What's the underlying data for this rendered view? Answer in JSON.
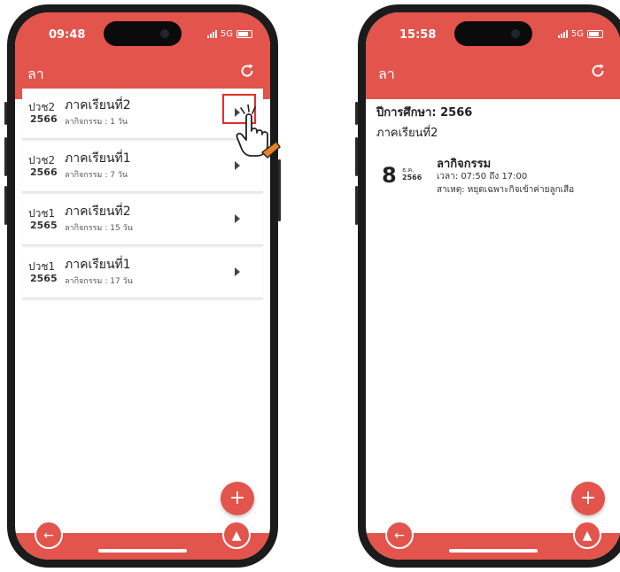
{
  "left_phone": {
    "status_time": "09:48",
    "network": "5G",
    "app_title": "ลา",
    "items": [
      {
        "code": "ปวช2",
        "year": "2566",
        "term": "ภาคเรียนที่2",
        "leave_type": "ลากิจกรรม",
        "days": ": 1 วัน"
      },
      {
        "code": "ปวช2",
        "year": "2566",
        "term": "ภาคเรียนที่1",
        "leave_type": "ลากิจกรรม",
        "days": ": 7 วัน"
      },
      {
        "code": "ปวช1",
        "year": "2565",
        "term": "ภาคเรียนที่2",
        "leave_type": "ลากิจกรรม",
        "days": ": 15 วัน"
      },
      {
        "code": "ปวช1",
        "year": "2565",
        "term": "ภาคเรียนที่1",
        "leave_type": "ลากิจกรรม",
        "days": ": 17 วัน"
      }
    ],
    "fab_label": "+",
    "back_label": "←",
    "up_label": "▲"
  },
  "right_phone": {
    "status_time": "15:58",
    "network": "5G",
    "app_title": "ลา",
    "academic_year": "ปีการศึกษา: 2566",
    "term": "ภาคเรียนที่2",
    "entry": {
      "day": "8",
      "month": "ธ.ค.",
      "year": "2566",
      "title": "ลากิจกรรม",
      "time": "เวลา: 07:50 ถึง 17:00",
      "reason": "สาเหตุ: หยุดเฉพาะกิจเข้าค่ายลูกเสือ"
    },
    "fab_label": "+",
    "back_label": "←",
    "up_label": "▲"
  },
  "colors": {
    "accent": "#e2544c",
    "highlight": "#e0302b"
  },
  "icons": [
    "refresh-icon",
    "chevron-right-icon",
    "plus-icon",
    "back-arrow-icon",
    "eject-up-icon",
    "pointer-hand-icon"
  ]
}
